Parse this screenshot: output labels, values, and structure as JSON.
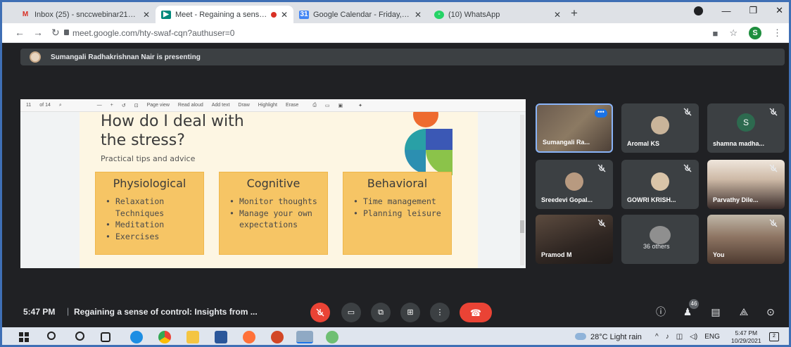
{
  "browser": {
    "tabs": [
      {
        "label": "Inbox (25) - snccwebinar21@gm",
        "icon": "gmail-icon"
      },
      {
        "label": "Meet - Regaining a sense of",
        "icon": "meet-icon",
        "recording": true
      },
      {
        "label": "Google Calendar - Friday, Octob",
        "icon": "calendar-icon"
      },
      {
        "label": "(10) WhatsApp",
        "icon": "whatsapp-icon"
      }
    ],
    "url": "meet.google.com/hty-swaf-cqn?authuser=0",
    "profile_initial": "S"
  },
  "meet": {
    "presenting_text": "Sumangali Radhakrishnan Nair is presenting",
    "pdf_toolbar": {
      "page": "11",
      "page_total": "of 14",
      "page_view": "Page view",
      "read_aloud": "Read aloud",
      "add_text": "Add text",
      "draw": "Draw",
      "highlight": "Highlight",
      "erase": "Erase"
    },
    "slide": {
      "title_line1": "How do I deal with",
      "title_line2": "the stress?",
      "subtitle": "Practical tips and advice",
      "columns": [
        {
          "heading": "Physiological",
          "items": [
            "Relaxation Techniques",
            "Meditation",
            "Exercises"
          ]
        },
        {
          "heading": "Cognitive",
          "items": [
            "Monitor thoughts",
            "Manage your own expectations"
          ]
        },
        {
          "heading": "Behavioral",
          "items": [
            "Time management",
            "Planning leisure"
          ]
        }
      ]
    },
    "participants": [
      {
        "name": "Sumangali Ra...",
        "type": "photo",
        "muted": false
      },
      {
        "name": "Aromal KS",
        "type": "avatar",
        "muted": true
      },
      {
        "name": "shamna madha...",
        "type": "initial",
        "initial": "S",
        "muted": true
      },
      {
        "name": "Sreedevi Gopal...",
        "type": "avatar",
        "muted": true
      },
      {
        "name": "GOWRI KRISH...",
        "type": "avatar",
        "muted": true
      },
      {
        "name": "Parvathy Dile...",
        "type": "photo",
        "muted": true
      },
      {
        "name": "Pramod M",
        "type": "photo",
        "muted": true
      },
      {
        "name": "36 others",
        "type": "group",
        "muted": false
      },
      {
        "name": "You",
        "type": "photo",
        "muted": true
      }
    ],
    "bottom": {
      "time": "5:47 PM",
      "separator": "|",
      "meeting_title": "Regaining a sense of control: Insights from ...",
      "people_count": "46"
    }
  },
  "taskbar": {
    "weather": "28°C  Light rain",
    "lang": "ENG",
    "time": "5:47 PM",
    "date": "10/29/2021",
    "notifications": "2"
  },
  "colors": {
    "meet_bg": "#202124",
    "tile_bg": "#3c4043",
    "danger": "#ea4335",
    "card_fill": "#f6c565",
    "slide_bg": "#fdf6e3"
  }
}
